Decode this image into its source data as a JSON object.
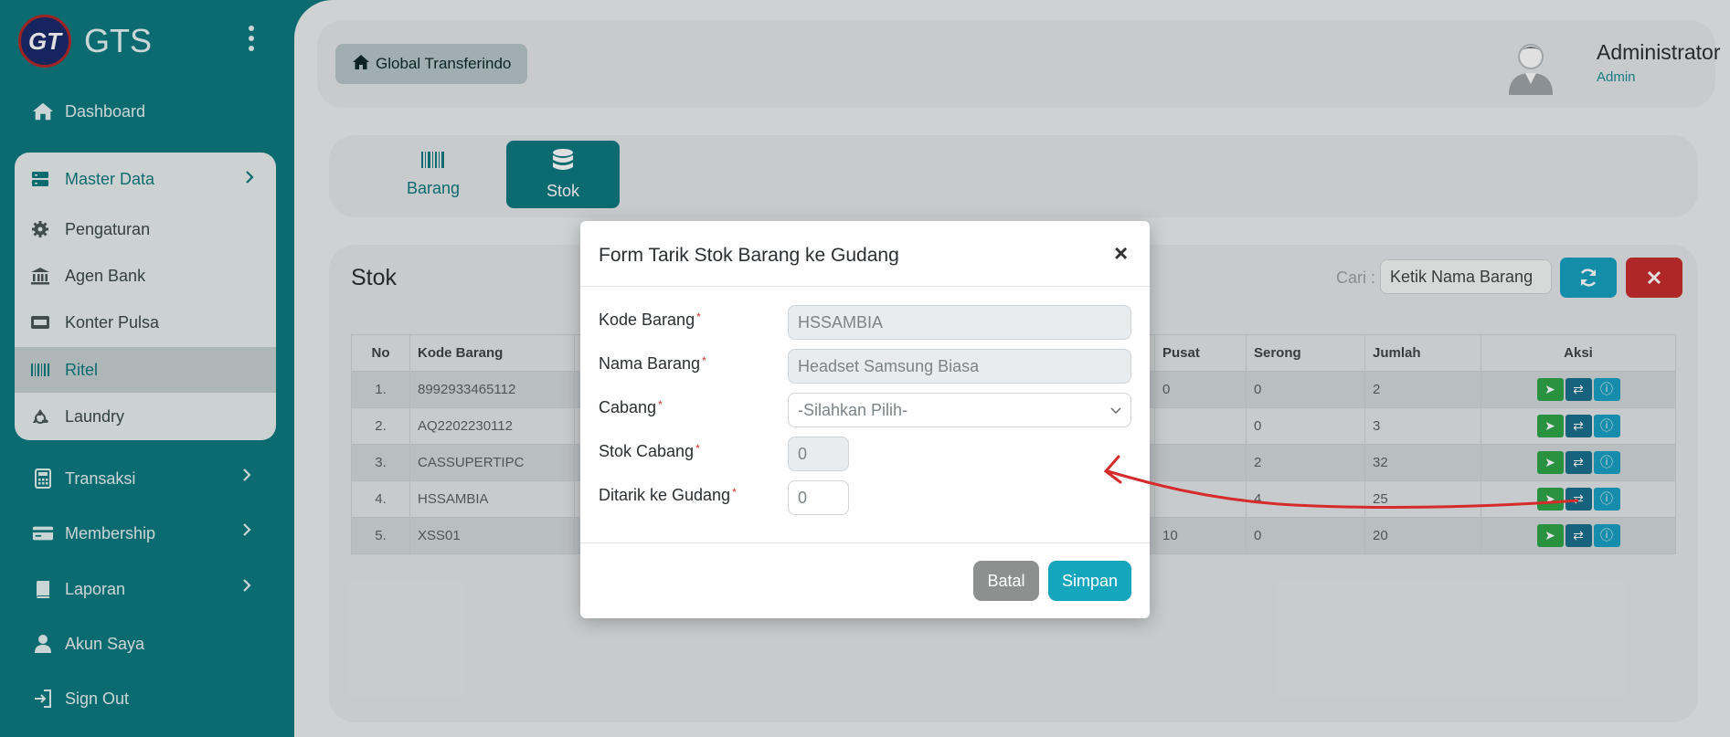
{
  "brand": {
    "logo_text": "GT",
    "name": "GTS"
  },
  "sidebar": {
    "dashboard": "Dashboard",
    "master_data": "Master Data",
    "sub_items": [
      "Pengaturan",
      "Agen Bank",
      "Konter Pulsa",
      "Ritel",
      "Laundry"
    ],
    "transaksi": "Transaksi",
    "membership": "Membership",
    "laporan": "Laporan",
    "akun_saya": "Akun Saya",
    "sign_out": "Sign Out"
  },
  "header": {
    "breadcrumb": "Global Transferindo",
    "user_name": "Administrator",
    "user_role": "Admin"
  },
  "tabs": {
    "barang": "Barang",
    "stok": "Stok"
  },
  "panel": {
    "title": "Stok",
    "search_label": "Cari :",
    "search_placeholder": "Ketik Nama Barang"
  },
  "table": {
    "headers": [
      "No",
      "Kode Barang",
      "Pusat",
      "Serong",
      "Jumlah",
      "Aksi"
    ],
    "rows": [
      {
        "no": "1.",
        "kode": "8992933465112",
        "pusat": "0",
        "serong": "0",
        "jumlah": "2"
      },
      {
        "no": "2.",
        "kode": "AQ2202230112",
        "pusat": "",
        "serong": "0",
        "jumlah": "3"
      },
      {
        "no": "3.",
        "kode": "CASSUPERTIPC",
        "pusat": "",
        "serong": "2",
        "jumlah": "32"
      },
      {
        "no": "4.",
        "kode": "HSSAMBIA",
        "pusat": "",
        "serong": "4",
        "jumlah": "25"
      },
      {
        "no": "5.",
        "kode": "XSS01",
        "pusat": "10",
        "serong": "0",
        "jumlah": "20"
      }
    ]
  },
  "modal": {
    "title": "Form Tarik Stok Barang ke Gudang",
    "close": "×",
    "fields": {
      "kode_label": "Kode Barang",
      "kode_value": "HSSAMBIA",
      "nama_label": "Nama Barang",
      "nama_value": "Headset Samsung Biasa",
      "cabang_label": "Cabang",
      "cabang_value": "-Silahkan Pilih-",
      "stok_label": "Stok Cabang",
      "stok_value": "0",
      "ditarik_label": "Ditarik ke Gudang",
      "ditarik_value": "0"
    },
    "required_mark": "*",
    "batal": "Batal",
    "simpan": "Simpan"
  },
  "colors": {
    "primary": "#0e7a80",
    "refresh": "#17a2c0",
    "danger": "#c82e2e",
    "send": "#2fa74a",
    "transfer": "#1a6f8c",
    "info": "#1aa1c5",
    "annotation": "#d62b2b"
  },
  "icons": {
    "dashboard": "home-icon",
    "master_data": "database-icon",
    "pengaturan": "gear-icon",
    "agen_bank": "bank-icon",
    "konter_pulsa": "sim-card-icon",
    "ritel": "barcode-icon",
    "laundry": "recycle-icon",
    "transaksi": "calculator-icon",
    "membership": "credit-card-icon",
    "laporan": "book-icon",
    "akun_saya": "user-icon",
    "sign_out": "sign-out-icon"
  }
}
